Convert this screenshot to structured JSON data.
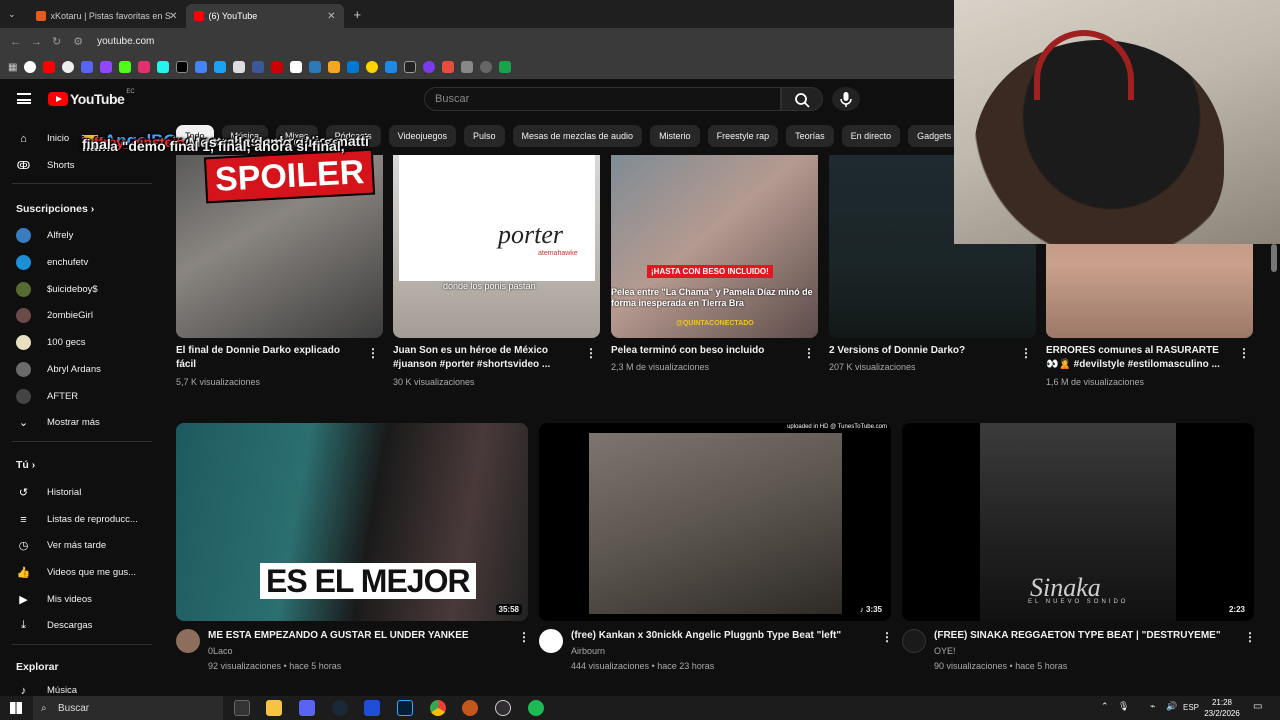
{
  "browser": {
    "tabs": [
      {
        "title": "xKotaru | Pistas favoritas en Sp...",
        "active": false,
        "fav_color": "#e35b1f"
      },
      {
        "title": "(6) YouTube",
        "active": true,
        "fav_color": "#ff0000"
      }
    ],
    "new_tab_label": "+",
    "url": "youtube.com"
  },
  "youtube": {
    "logo_text": "YouTube",
    "country_code": "EC",
    "search_placeholder": "Buscar",
    "chips": [
      "Todo",
      "Música",
      "Mixes",
      "Pódcasts",
      "Videojuegos",
      "Pulso",
      "Mesas de mezclas de audio",
      "Misterio",
      "Freestyle rap",
      "Teorías",
      "En directo",
      "Gadgets"
    ],
    "sidebar": {
      "home": "Inicio",
      "shorts": "Shorts",
      "subs_header": "Suscripciones",
      "subs": [
        {
          "name": "Alfrely",
          "color": "#3a7dbf"
        },
        {
          "name": "enchufetv",
          "color": "#1c8fd6"
        },
        {
          "name": "$uicideboy$",
          "color": "#556b2f"
        },
        {
          "name": "2ombieGirl",
          "color": "#6b4a4a"
        },
        {
          "name": "100 gecs",
          "color": "#e8e0c0"
        },
        {
          "name": "Abryl Ardans",
          "color": "#6a6a6a"
        },
        {
          "name": "AFTER",
          "color": "#444"
        }
      ],
      "more": "Mostrar más",
      "you_header": "Tú",
      "you_items": [
        "Historial",
        "Listas de reproducc...",
        "Ver más tarde",
        "Videos que me gus...",
        "Mis videos",
        "Descargas"
      ],
      "explore_header": "Explorar",
      "explore_items": [
        "Música"
      ]
    },
    "shorts_row": [
      {
        "title": "El final de Donnie Darko explicado fácil",
        "meta": "5,7 K visualizaciones"
      },
      {
        "title": "Juan Son es un héroe de México #juanson #porter #shortsvideo ...",
        "meta": "30 K visualizaciones"
      },
      {
        "title": "Pelea terminó con beso incluido",
        "meta": "2,3 M de visualizaciones"
      },
      {
        "title": "2 Versions of Donnie Darko?",
        "meta": "207 K visualizaciones"
      },
      {
        "title": "ERRORES comunes al RASURARTE 👀🙎 #devilstyle #estilomasculino ...",
        "meta": "1,6 M de visualizaciones"
      }
    ],
    "short_overlays": {
      "porter_logo": "porter",
      "porter_sub": "atemahawke",
      "porter_caption": "donde los ponis pastan",
      "kiss_badge": "¡HASTA CON BESO INCLUIDO!",
      "kiss_caption": "Pelea entre \"La Chama\" y Pamela Díaz minó de forma inesperada en Tierra Bra",
      "kiss_handle": "@QUINTACONECTADO"
    },
    "videos": [
      {
        "title": "ME ESTA EMPEZANDO A GUSTAR EL UNDER YANKEE",
        "channel": "0Laco",
        "meta": "92 visualizaciones • hace 5 horas",
        "duration": "35:58",
        "overlay": "ES EL MEJOR"
      },
      {
        "title": "(free) Kankan x 30nickk Angelic Pluggnb Type Beat \"left\"",
        "channel": "Airbourn",
        "meta": "444 visualizaciones • hace 23 horas",
        "duration": "♪ 3:35",
        "overlay": "uploaded in HD @ TunesToTube.com"
      },
      {
        "title": "(FREE) SINAKA REGGAETON TYPE BEAT | \"DESTRUYEME\"",
        "channel": "OYE!",
        "meta": "90 visualizaciones • hace 5 horas",
        "duration": "2:23",
        "overlay": "Sinaka",
        "overlay_sub": "EL NUEVO SONIDO"
      }
    ]
  },
  "stream_chat": [
    {
      "user": "AngelBG",
      "user_color": "#4da3ff",
      "text": "no manches pobre Nicomatti"
    },
    {
      "user": "jeffrey_einstein",
      "user_color": "#ff3030",
      "text": "Mostra la demo que se"
    },
    {
      "user": "",
      "user_color": "#ffffff",
      "text": "llama \"demo final 1, final, ahora si final,"
    },
    {
      "user": "",
      "user_color": "#ffffff",
      "text": "final"
    }
  ],
  "spoiler_text": "SPOILER",
  "taskbar": {
    "search": "Buscar",
    "lang": "ESP",
    "time": "21:28",
    "date": "23/2/2026"
  }
}
